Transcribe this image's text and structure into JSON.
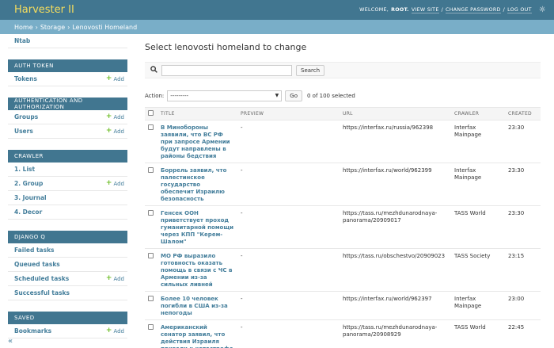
{
  "header": {
    "brand": "Harvester II",
    "welcome": "WELCOME,",
    "username": "ROOT.",
    "view_site": "VIEW SITE",
    "sep1": "/",
    "change_password": "CHANGE PASSWORD",
    "sep2": "/",
    "logout": "LOG OUT",
    "theme_icon": "☼"
  },
  "breadcrumbs": {
    "home": "Home",
    "sep1": "›",
    "app": "Storage",
    "sep2": "›",
    "current": "Lenovosti Homeland"
  },
  "sidebar": {
    "cut_item": "Ntab",
    "add_label": "Add",
    "add_icon": "+",
    "collapse": "«",
    "modules": [
      {
        "caption": "AUTH TOKEN",
        "rows": [
          {
            "label": "Tokens",
            "add": true
          }
        ]
      },
      {
        "caption": "AUTHENTICATION AND AUTHORIZATION",
        "rows": [
          {
            "label": "Groups",
            "add": true
          },
          {
            "label": "Users",
            "add": true
          }
        ]
      },
      {
        "caption": "CRAWLER",
        "rows": [
          {
            "label": "1. List",
            "add": false
          },
          {
            "label": "2. Group",
            "add": true
          },
          {
            "label": "3. Journal",
            "add": false
          },
          {
            "label": "4. Decor",
            "add": false
          }
        ]
      },
      {
        "caption": "DJANGO Q",
        "rows": [
          {
            "label": "Failed tasks",
            "add": false
          },
          {
            "label": "Queued tasks",
            "add": false
          },
          {
            "label": "Scheduled tasks",
            "add": true
          },
          {
            "label": "Successful tasks",
            "add": false
          }
        ]
      },
      {
        "caption": "SAVED",
        "rows": [
          {
            "label": "Bookmarks",
            "add": true
          }
        ]
      }
    ]
  },
  "main": {
    "title": "Select lenovosti homeland to change",
    "search": {
      "icon": "search-icon",
      "value": "",
      "button": "Search"
    },
    "actions": {
      "label": "Action:",
      "selected": "---------",
      "go": "Go",
      "count": "0 of 100 selected"
    },
    "columns": [
      "TITLE",
      "PREVIEW",
      "URL",
      "CRAWLER",
      "CREATED"
    ],
    "rows": [
      {
        "title": "В Минобороны заявили, что ВС РФ при запросе Армении будут направлены в районы бедствия",
        "preview": "-",
        "url": "https://interfax.ru/russia/962398",
        "crawler": "Interfax Mainpage",
        "created": "23:30"
      },
      {
        "title": "Боррель заявил, что палестинское государство обеспечит Израилю безопасность",
        "preview": "-",
        "url": "https://interfax.ru/world/962399",
        "crawler": "Interfax Mainpage",
        "created": "23:30"
      },
      {
        "title": "Генсек ООН приветствует проход гуманитарной помощи через КПП \"Керем-Шалом\"",
        "preview": "-",
        "url": "https://tass.ru/mezhdunarodnaya-panorama/20909017",
        "crawler": "TASS World",
        "created": "23:30"
      },
      {
        "title": "МО РФ выразило готовность оказать помощь в связи с ЧС в Армении из-за сильных ливней",
        "preview": "-",
        "url": "https://tass.ru/obschestvo/20909023",
        "crawler": "TASS Society",
        "created": "23:15"
      },
      {
        "title": "Более 10 человек погибли в США из-за непогоды",
        "preview": "-",
        "url": "https://interfax.ru/world/962397",
        "crawler": "Interfax Mainpage",
        "created": "23:00"
      },
      {
        "title": "Американский сенатор заявил, что действия Израиля привели к катастрофе в Рафахе",
        "preview": "-",
        "url": "https://tass.ru/mezhdunarodnaya-panorama/20908929",
        "crawler": "TASS World",
        "created": "22:45"
      }
    ]
  }
}
